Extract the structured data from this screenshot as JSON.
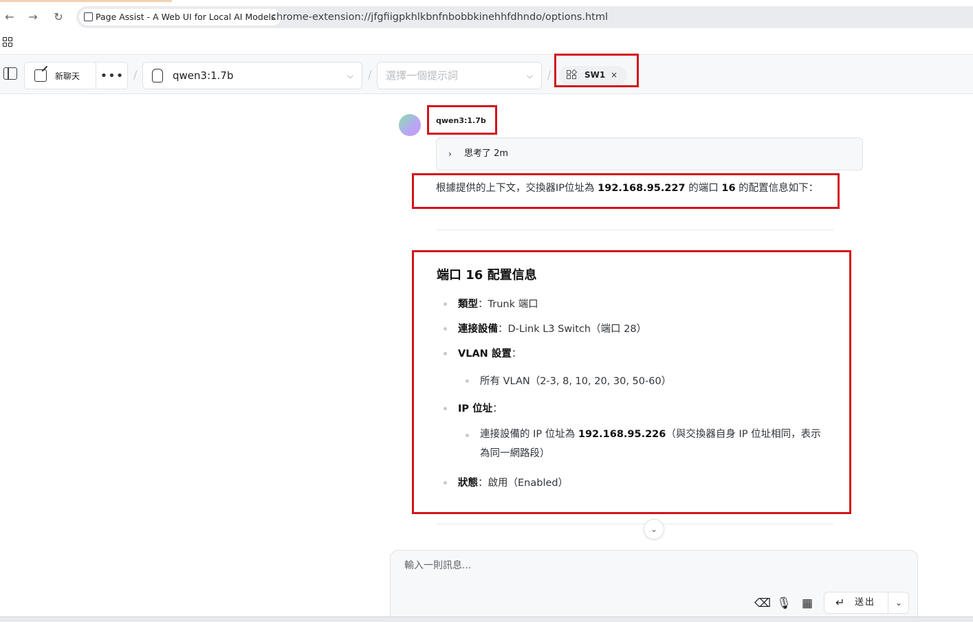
{
  "browser": {
    "tab_title": "Page Assist - A Web UI for Local AI Models",
    "url": "chrome-extension://jfgfiigpkhlkbnfnbobbkinehhfdhndo/options.html",
    "back_icon": "←",
    "forward_icon": "→",
    "reload_icon": "↻"
  },
  "header": {
    "new_chat_label": "新聊天",
    "more_label": "•••",
    "separator": "/",
    "model_selected": "qwen3:1.7b",
    "prompt_placeholder": "選擇一個提示詞",
    "knowledge_tag": "SW1",
    "tag_close": "×",
    "chevron": "⌵"
  },
  "message": {
    "model_name": "qwen3:1.7b",
    "thinking_label": "思考了 2m",
    "thinking_arrow": "›",
    "intro_pre": "根據提供的上下文，交換器IP位址為 ",
    "intro_ip": "192.168.95.227",
    "intro_mid": " 的端口 ",
    "intro_port": "16",
    "intro_post": " 的配置信息如下：",
    "section_title": "端口 16 配置信息",
    "items": [
      {
        "key": "類型",
        "sep": "：",
        "value": "Trunk 端口"
      },
      {
        "key": "連接設備",
        "sep": "：",
        "value": "D-Link L3 Switch（端口 28）"
      },
      {
        "key": "VLAN 設置",
        "sep": "：",
        "value": ""
      },
      {
        "key": "",
        "sep": "",
        "value": "所有 VLAN（2-3, 8, 10, 20, 30, 50-60）"
      },
      {
        "key": "IP 位址",
        "sep": "：",
        "value": ""
      },
      {
        "key": "",
        "sep": "",
        "value_pre": "連接設備的 IP 位址為 ",
        "value_bold": "192.168.95.226",
        "value_post": "（與交換器自身 IP 位址相同，表示為同一網路段）"
      },
      {
        "key": "狀態",
        "sep": "：",
        "value": "啟用（Enabled）"
      }
    ],
    "scroll_down_icon": "⌄"
  },
  "composer": {
    "placeholder": "輸入一則訊息...",
    "send_label": "送出",
    "send_icon": "↵",
    "send_chevron": "⌄",
    "eraser_icon": "⌫",
    "mic_icon": "🎙",
    "tools_icon": "▦"
  }
}
